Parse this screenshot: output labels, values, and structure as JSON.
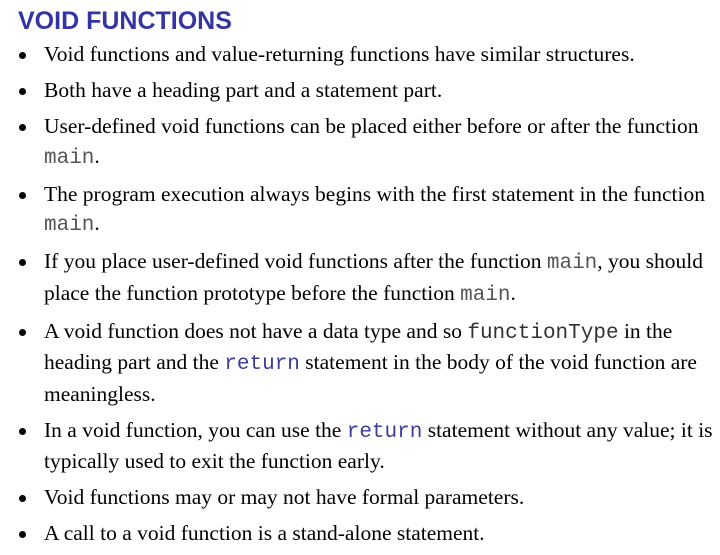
{
  "slide": {
    "title": "VOID FUNCTIONS",
    "title_color": "#3434a4",
    "bullets": [
      {
        "parts": [
          {
            "text": "Void functions and value-returning functions have similar structures.",
            "type": "text"
          }
        ]
      },
      {
        "parts": [
          {
            "text": "Both have a heading part and a statement part.",
            "type": "text"
          }
        ]
      },
      {
        "parts": [
          {
            "text": "User-defined void functions can be placed either before or after the function ",
            "type": "text"
          },
          {
            "text": "main",
            "type": "code"
          },
          {
            "text": ".",
            "type": "text"
          }
        ]
      },
      {
        "parts": [
          {
            "text": "The program execution always begins with the first statement in the function ",
            "type": "text"
          },
          {
            "text": "main",
            "type": "code"
          },
          {
            "text": ".",
            "type": "text"
          }
        ]
      },
      {
        "parts": [
          {
            "text": "If you place user-defined void functions after the function ",
            "type": "text"
          },
          {
            "text": "main",
            "type": "code"
          },
          {
            "text": ", you should place the function prototype before the function ",
            "type": "text"
          },
          {
            "text": "main",
            "type": "code"
          },
          {
            "text": ".",
            "type": "text"
          }
        ]
      },
      {
        "parts": [
          {
            "text": "A void function does not have a data type and so ",
            "type": "text"
          },
          {
            "text": "functionType",
            "type": "code-plain"
          },
          {
            "text": " in the heading part and the ",
            "type": "text"
          },
          {
            "text": "return",
            "type": "keyword"
          },
          {
            "text": " statement in the body of the void function are meaningless.",
            "type": "text"
          }
        ]
      },
      {
        "parts": [
          {
            "text": "In a void function, you can use the ",
            "type": "text"
          },
          {
            "text": "return",
            "type": "keyword"
          },
          {
            "text": " statement without any value; it is typically used to exit the function early.",
            "type": "text"
          }
        ]
      },
      {
        "parts": [
          {
            "text": "Void functions may or may not have formal parameters.",
            "type": "text"
          }
        ]
      },
      {
        "parts": [
          {
            "text": "A call to a void function is a stand-alone statement.",
            "type": "text"
          }
        ]
      }
    ]
  }
}
